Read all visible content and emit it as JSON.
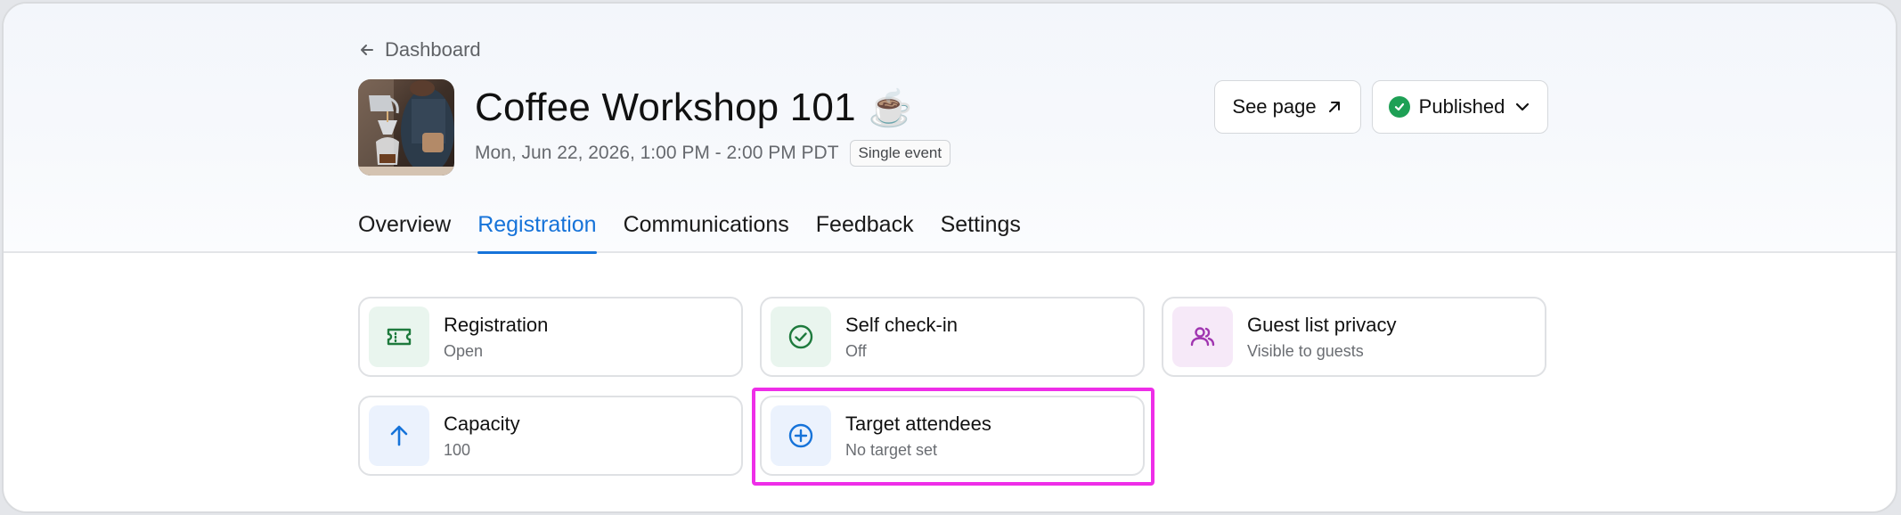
{
  "nav": {
    "back_label": "Dashboard"
  },
  "event": {
    "title": "Coffee Workshop 101",
    "title_emoji": "☕",
    "date": "Mon, Jun 22, 2026, 1:00 PM - 2:00 PM PDT",
    "type_badge": "Single event",
    "thumbnail_icon": "coffee-pour-over-photo"
  },
  "actions": {
    "see_page_label": "See page",
    "see_page_icon": "arrow-up-right-icon",
    "status_label": "Published",
    "status_icon": "check-circle-icon",
    "status_color": "#1ea055",
    "status_dropdown_icon": "chevron-down-icon"
  },
  "tabs": [
    {
      "label": "Overview",
      "active": false
    },
    {
      "label": "Registration",
      "active": true
    },
    {
      "label": "Communications",
      "active": false
    },
    {
      "label": "Feedback",
      "active": false
    },
    {
      "label": "Settings",
      "active": false
    }
  ],
  "cards": [
    {
      "title": "Registration",
      "subtitle": "Open",
      "icon": "ticket-icon",
      "icon_color": "#1e7a3d"
    },
    {
      "title": "Self check-in",
      "subtitle": "Off",
      "icon": "check-circle-outline-icon",
      "icon_color": "#1e7a3d"
    },
    {
      "title": "Guest list privacy",
      "subtitle": "Visible to guests",
      "icon": "users-icon",
      "icon_color": "#a035b0"
    },
    {
      "title": "Capacity",
      "subtitle": "100",
      "icon": "arrow-up-icon",
      "icon_color": "#1673d9"
    },
    {
      "title": "Target attendees",
      "subtitle": "No target set",
      "icon": "plus-circle-icon",
      "icon_color": "#1673d9"
    }
  ],
  "colors": {
    "accent": "#1673d9",
    "highlight": "#ee2ee8"
  }
}
